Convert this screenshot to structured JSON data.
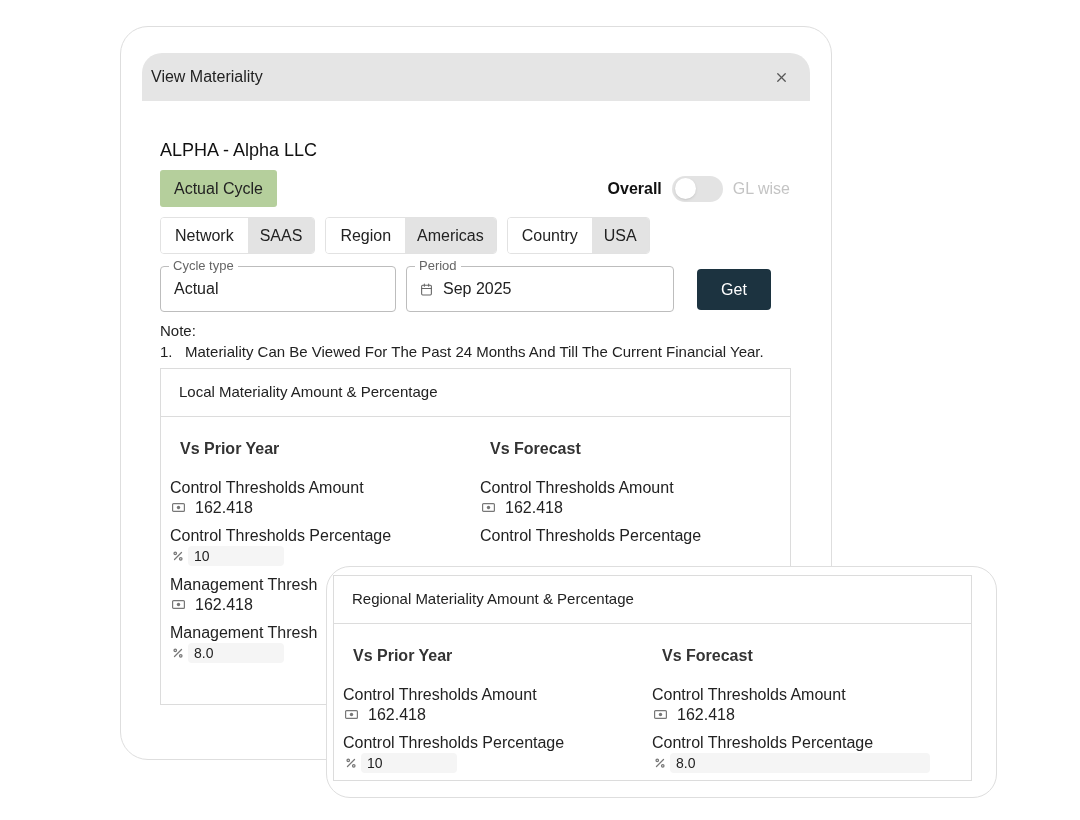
{
  "dialog": {
    "title": "View Materiality"
  },
  "entity": "ALPHA - Alpha LLC",
  "cycle_badge": "Actual Cycle",
  "view_toggle": {
    "left_label": "Overall",
    "right_label": "GL wise",
    "on": false
  },
  "filters": [
    {
      "label": "Network",
      "value": "SAAS"
    },
    {
      "label": "Region",
      "value": "Americas"
    },
    {
      "label": "Country",
      "value": "USA"
    }
  ],
  "fields": [
    {
      "label": "Cycle type",
      "value": "Actual",
      "kind": "text"
    },
    {
      "label": "Period",
      "value": "Sep 2025",
      "kind": "date"
    }
  ],
  "get_button": "Get",
  "note": {
    "heading": "Note:",
    "items": [
      {
        "number": "1.",
        "text": "Materiality Can Be Viewed For The Past 24 Months And Till The Current Financial Year."
      }
    ]
  },
  "local_section": {
    "title": "Local Materiality Amount & Percentage",
    "columns": [
      {
        "heading": "Vs Prior Year",
        "items": [
          {
            "label": "Control Thresholds Amount",
            "kind": "amount",
            "value": "162.418"
          },
          {
            "label": "Control Thresholds Percentage",
            "kind": "percent",
            "value": "10"
          },
          {
            "label": "Management Thresh",
            "kind": "amount",
            "value": "162.418"
          },
          {
            "label": "Management Thresh",
            "kind": "percent",
            "value": "8.0"
          }
        ]
      },
      {
        "heading": "Vs Forecast",
        "items": [
          {
            "label": "Control Thresholds Amount",
            "kind": "amount",
            "value": "162.418"
          },
          {
            "label": "Control Thresholds Percentage",
            "kind": "label"
          }
        ]
      }
    ]
  },
  "regional_section": {
    "title": "Regional Materiality Amount & Percentage",
    "columns": [
      {
        "heading": "Vs Prior Year",
        "items": [
          {
            "label": "Control Thresholds Amount",
            "kind": "amount",
            "value": "162.418"
          },
          {
            "label": "Control Thresholds Percentage",
            "kind": "percent",
            "value": "10"
          }
        ]
      },
      {
        "heading": "Vs Forecast",
        "items": [
          {
            "label": "Control Thresholds Amount",
            "kind": "amount",
            "value": "162.418"
          },
          {
            "label": "Control Thresholds Percentage",
            "kind": "percent",
            "value": "8.0"
          }
        ]
      }
    ]
  }
}
